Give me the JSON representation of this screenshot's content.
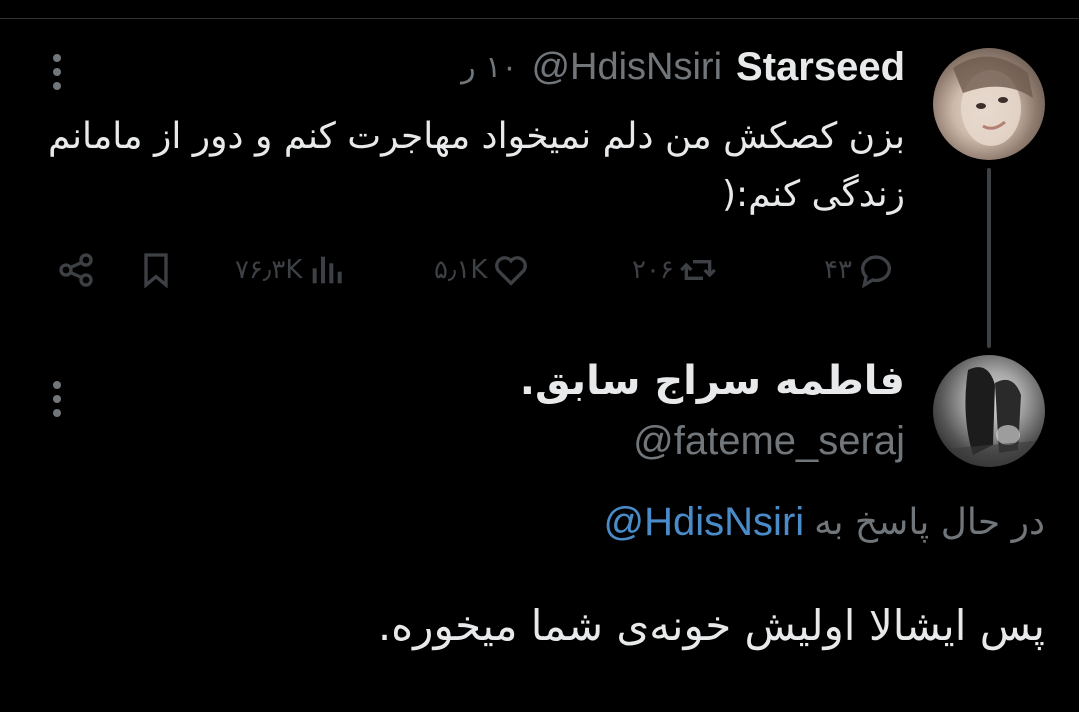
{
  "colors": {
    "background": "#000000",
    "primary_text": "#e7e9ea",
    "secondary_text": "#71767b",
    "action_icons": "#3d4044",
    "link": "#4a8cc9"
  },
  "original_tweet": {
    "display_name": "Starseed",
    "handle": "@HdisNsiri",
    "time": "۱۰ ر",
    "text": "بزن کصکش من دلم نمیخواد مهاجرت کنم و دور از مامانم زندگی کنم:(",
    "metrics": {
      "replies": "۴۳",
      "retweets": "۲۰۶",
      "likes": "۵٫۱K",
      "views": "۷۶٫۳K"
    },
    "icons": {
      "more": "more-vertical-icon",
      "reply": "reply-icon",
      "retweet": "retweet-icon",
      "like": "heart-icon",
      "views": "views-icon",
      "bookmark": "bookmark-icon",
      "share": "share-icon"
    }
  },
  "reply_tweet": {
    "display_name": "فاطمه سراج سابق.",
    "handle": "@fateme_seraj",
    "replying_to_label": "در حال پاسخ به",
    "replying_to_handle": "@HdisNsiri",
    "text": "پس ایشالا اولیش خونه‌ی شما میخوره."
  }
}
